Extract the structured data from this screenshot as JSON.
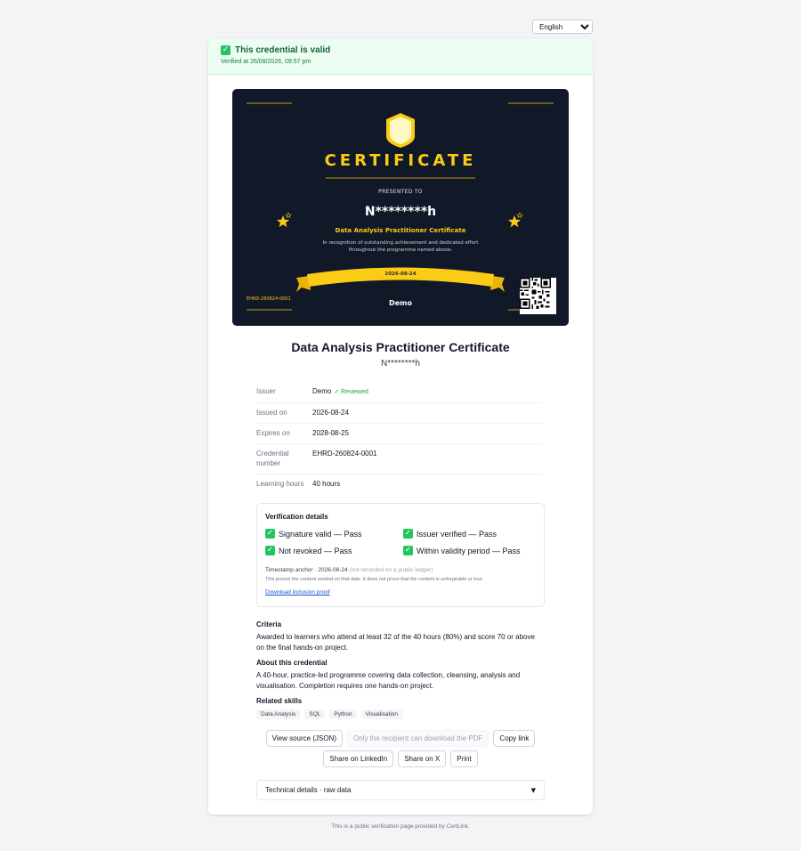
{
  "language": {
    "selected": "English"
  },
  "banner": {
    "title": "This credential is valid",
    "verified_at": "Verified at 26/08/2026, 09:57 pm",
    "check": "✓"
  },
  "certificate": {
    "heading": "CERTIFICATE",
    "presented_to": "PRESENTED TO",
    "name": "N********h",
    "course": "Data Analysis Practitioner Certificate",
    "description": "In recognition of outstanding achievement and dedicated effort throughout the programme named above.",
    "date": "2026-08-24",
    "issuer": "Demo",
    "number": "EHRD-260824-0001",
    "colors": {
      "background": "#111827",
      "accent": "#facc15"
    }
  },
  "title": "Data Analysis Practitioner Certificate",
  "recipient": "N********h",
  "info": [
    {
      "label": "Issuer",
      "value": "Demo",
      "badge": "✓ Reviewed"
    },
    {
      "label": "Issued on",
      "value": "2026-08-24"
    },
    {
      "label": "Expires on",
      "value": "2028-08-25"
    },
    {
      "label": "Credential number",
      "value": "EHRD-260824-0001"
    },
    {
      "label": "Learning hours",
      "value": "40 hours"
    }
  ],
  "verification": {
    "title": "Verification details",
    "checks": [
      "Signature valid — Pass",
      "Issuer verified — Pass",
      "Not revoked — Pass",
      "Within validity period — Pass"
    ],
    "anchor_label": "Timestamp anchor · 2026-08-24",
    "anchor_note": "(not recorded on a public ledger)",
    "anchor_explain": "This proves the content existed on that date. It does not prove that the content is unforgeable or true.",
    "proof_link": "Download inclusion proof"
  },
  "criteria": {
    "heading": "Criteria",
    "text": "Awarded to learners who attend at least 32 of the 40 hours (80%) and score 70 or above on the final hands-on project."
  },
  "about": {
    "heading": "About this credential",
    "text": "A 40-hour, practice-led programme covering data collection, cleansing, analysis and visualisation. Completion requires one hands-on project."
  },
  "skills": {
    "heading": "Related skills",
    "items": [
      "Data Analysis",
      "SQL",
      "Python",
      "Visualisation"
    ]
  },
  "actions": {
    "view_source": "View source (JSON)",
    "pdf_disabled": "Only the recipient can download the PDF",
    "copy_link": "Copy link",
    "share_linkedin": "Share on LinkedIn",
    "share_x": "Share on X",
    "print": "Print"
  },
  "technical": {
    "label": "Technical details · raw data",
    "arrow": "▼"
  },
  "footer": "This is a public verification page provided by CertLink."
}
